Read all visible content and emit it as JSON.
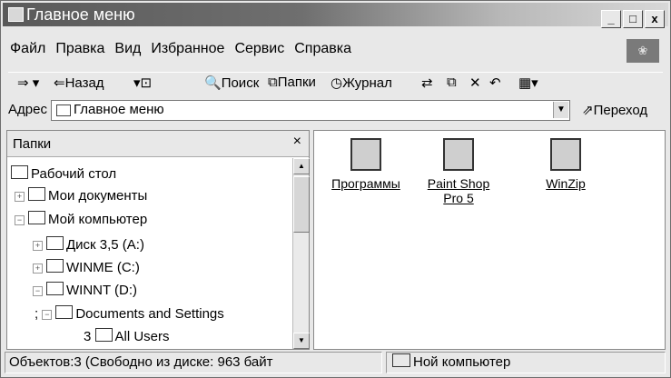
{
  "window": {
    "title": "Главное меню"
  },
  "menu": [
    "Файл",
    "Правка",
    "Вид",
    "Избранное",
    "Сервис",
    "Справка"
  ],
  "toolbar": {
    "back": "Назад",
    "search": "Поиск",
    "folders": "Папки",
    "history": "Журнал"
  },
  "address": {
    "label": "Адрес",
    "value": "Главное меню",
    "go": "Переход"
  },
  "folders_pane": {
    "title": "Папки",
    "close": "×",
    "tree": [
      {
        "label": "Рабочий стол",
        "prefix": "",
        "expander": ""
      },
      {
        "label": "Мои документы",
        "prefix": "",
        "expander": "+"
      },
      {
        "label": "Мой компьютер",
        "prefix": "",
        "expander": "−"
      },
      {
        "label": "Диск 3,5 (A:)",
        "prefix": "",
        "expander": "+"
      },
      {
        "label": "WINME (C:)",
        "prefix": "",
        "expander": "+"
      },
      {
        "label": "WINNT (D:)",
        "prefix": "",
        "expander": "−"
      },
      {
        "label": "Documents and Settings",
        "prefix": ";",
        "expander": "−"
      },
      {
        "label": "All Users",
        "prefix": "3",
        "expander": ""
      }
    ]
  },
  "content": {
    "items": [
      {
        "label": "Программы",
        "icon": "programs-folder-icon"
      },
      {
        "label": "Paint Shop Pro 5",
        "icon": "paint-shop-pro-icon"
      },
      {
        "label": "WinZip",
        "icon": "winzip-icon"
      }
    ]
  },
  "status": {
    "left": "Объектов:3 (Свободно из диске: 963 байт",
    "right": "Ной компьютер"
  }
}
